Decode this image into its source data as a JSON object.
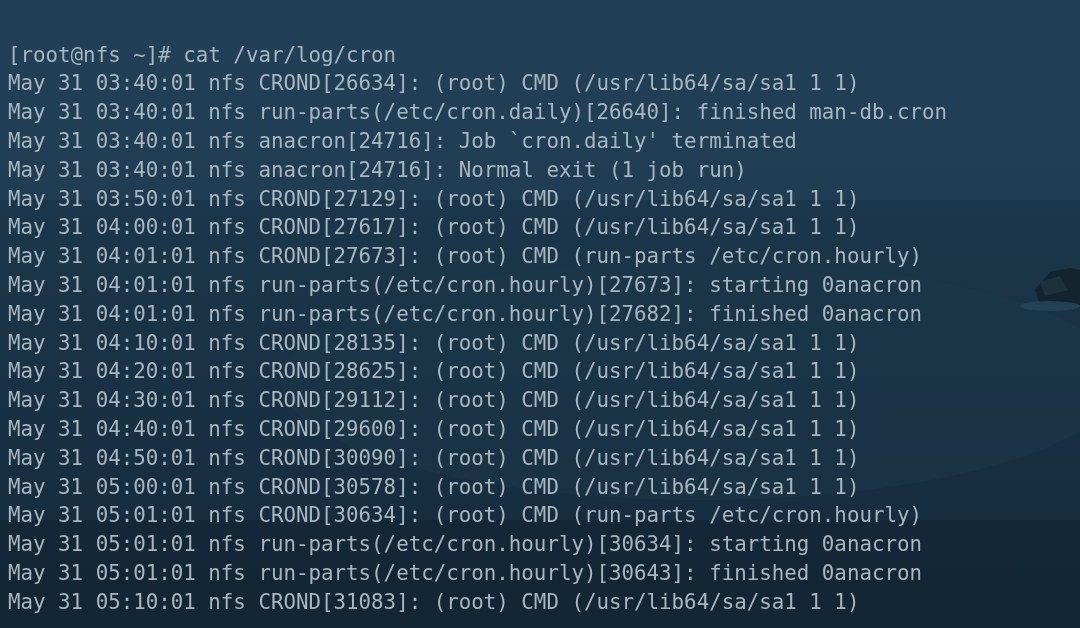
{
  "terminal": {
    "lines": [
      {
        "kind": "prompt",
        "text": "[root@nfs ~]# cat /var/log/cron"
      },
      {
        "kind": "output",
        "text": "May 31 03:40:01 nfs CROND[26634]: (root) CMD (/usr/lib64/sa/sa1 1 1)"
      },
      {
        "kind": "output",
        "text": "May 31 03:40:01 nfs run-parts(/etc/cron.daily)[26640]: finished man-db.cron"
      },
      {
        "kind": "output",
        "text": "May 31 03:40:01 nfs anacron[24716]: Job `cron.daily' terminated"
      },
      {
        "kind": "output",
        "text": "May 31 03:40:01 nfs anacron[24716]: Normal exit (1 job run)"
      },
      {
        "kind": "output",
        "text": "May 31 03:50:01 nfs CROND[27129]: (root) CMD (/usr/lib64/sa/sa1 1 1)"
      },
      {
        "kind": "output",
        "text": "May 31 04:00:01 nfs CROND[27617]: (root) CMD (/usr/lib64/sa/sa1 1 1)"
      },
      {
        "kind": "output",
        "text": "May 31 04:01:01 nfs CROND[27673]: (root) CMD (run-parts /etc/cron.hourly)"
      },
      {
        "kind": "output",
        "text": "May 31 04:01:01 nfs run-parts(/etc/cron.hourly)[27673]: starting 0anacron"
      },
      {
        "kind": "output",
        "text": "May 31 04:01:01 nfs run-parts(/etc/cron.hourly)[27682]: finished 0anacron"
      },
      {
        "kind": "output",
        "text": "May 31 04:10:01 nfs CROND[28135]: (root) CMD (/usr/lib64/sa/sa1 1 1)"
      },
      {
        "kind": "output",
        "text": "May 31 04:20:01 nfs CROND[28625]: (root) CMD (/usr/lib64/sa/sa1 1 1)"
      },
      {
        "kind": "output",
        "text": "May 31 04:30:01 nfs CROND[29112]: (root) CMD (/usr/lib64/sa/sa1 1 1)"
      },
      {
        "kind": "output",
        "text": "May 31 04:40:01 nfs CROND[29600]: (root) CMD (/usr/lib64/sa/sa1 1 1)"
      },
      {
        "kind": "output",
        "text": "May 31 04:50:01 nfs CROND[30090]: (root) CMD (/usr/lib64/sa/sa1 1 1)"
      },
      {
        "kind": "output",
        "text": "May 31 05:00:01 nfs CROND[30578]: (root) CMD (/usr/lib64/sa/sa1 1 1)"
      },
      {
        "kind": "output",
        "text": "May 31 05:01:01 nfs CROND[30634]: (root) CMD (run-parts /etc/cron.hourly)"
      },
      {
        "kind": "output",
        "text": "May 31 05:01:01 nfs run-parts(/etc/cron.hourly)[30634]: starting 0anacron"
      },
      {
        "kind": "output",
        "text": "May 31 05:01:01 nfs run-parts(/etc/cron.hourly)[30643]: finished 0anacron"
      },
      {
        "kind": "output",
        "text": "May 31 05:10:01 nfs CROND[31083]: (root) CMD (/usr/lib64/sa/sa1 1 1)"
      }
    ]
  }
}
